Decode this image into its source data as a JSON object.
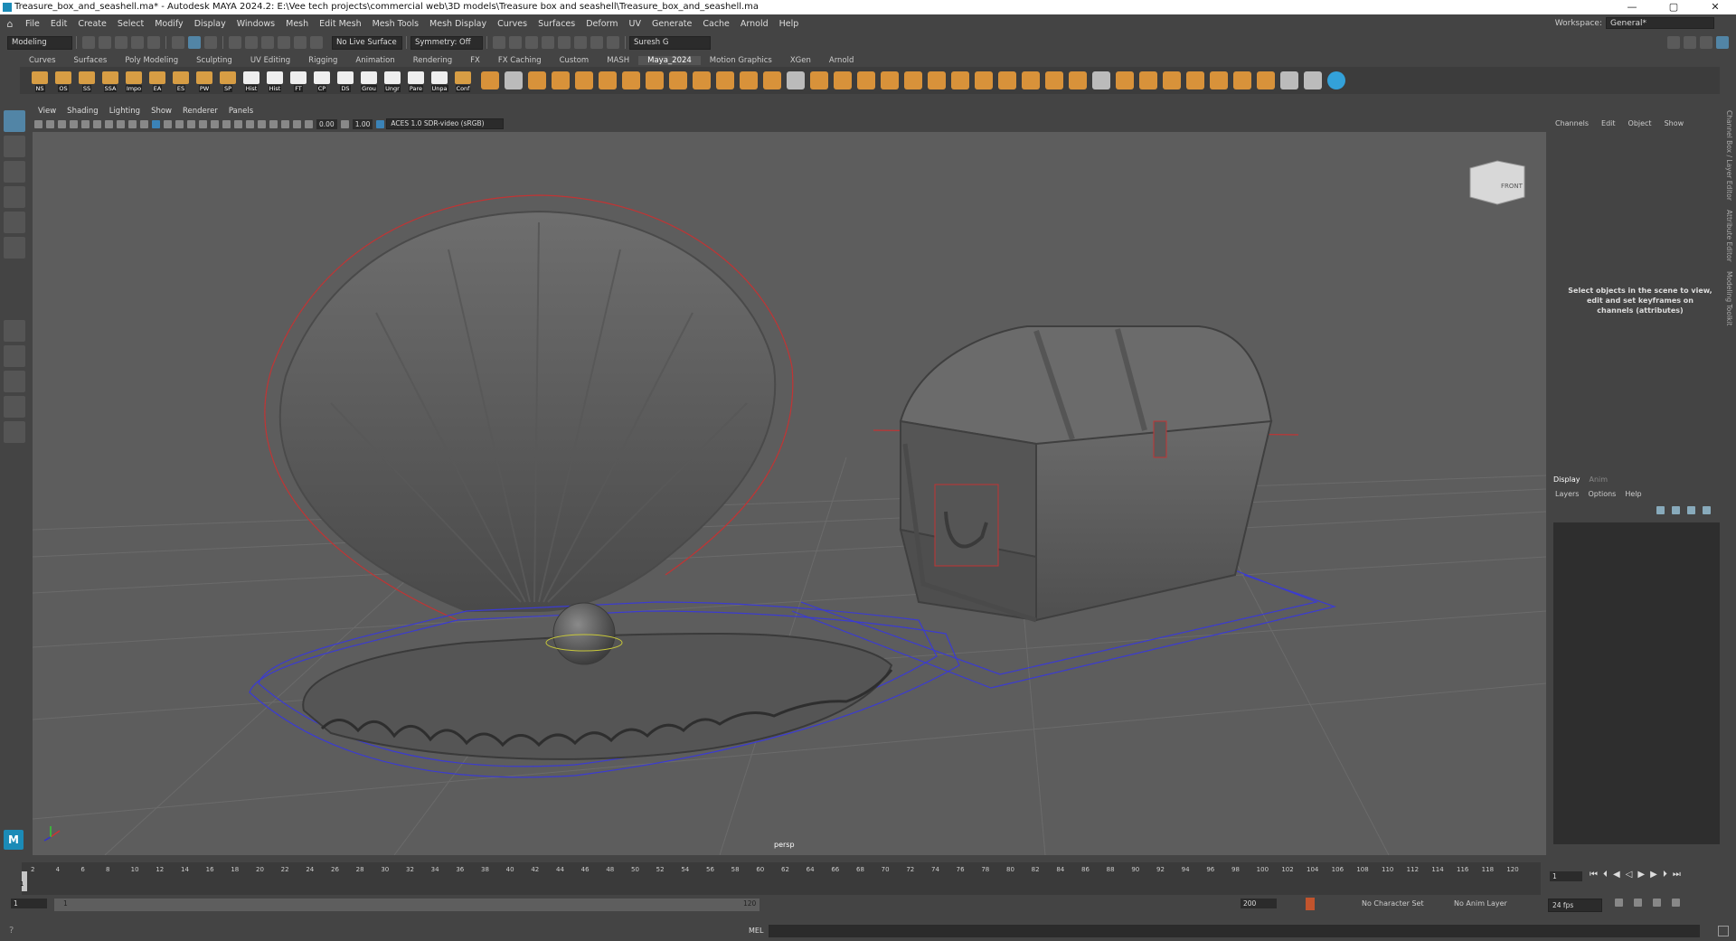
{
  "window": {
    "title": "Treasure_box_and_seashell.ma* - Autodesk MAYA 2024.2: E:\\Vee tech projects\\commercial web\\3D models\\Treasure box and seashell\\Treasure_box_and_seashell.ma",
    "minimize": "—",
    "maximize": "▢",
    "close": "✕"
  },
  "menubar": {
    "items": [
      "File",
      "Edit",
      "Create",
      "Select",
      "Modify",
      "Display",
      "Windows",
      "Mesh",
      "Edit Mesh",
      "Mesh Tools",
      "Mesh Display",
      "Curves",
      "Surfaces",
      "Deform",
      "UV",
      "Generate",
      "Cache",
      "Arnold",
      "Help"
    ],
    "workspace_label": "Workspace:",
    "workspace_value": "General*"
  },
  "statusline": {
    "mode": "Modeling",
    "live_surface": "No Live Surface",
    "symmetry": "Symmetry: Off",
    "user": "Suresh G"
  },
  "shelf": {
    "tabs": [
      "Curves",
      "Surfaces",
      "Poly Modeling",
      "Sculpting",
      "UV Editing",
      "Rigging",
      "Animation",
      "Rendering",
      "FX",
      "FX Caching",
      "Custom",
      "MASH",
      "Maya_2024",
      "Motion Graphics",
      "XGen",
      "Arnold"
    ],
    "active_tab": "Maya_2024",
    "buttons": [
      "NS",
      "OS",
      "SS",
      "SSA",
      "Impo",
      "EA",
      "ES",
      "PW",
      "SP",
      "Hist",
      "Hist",
      "FT",
      "CP",
      "DS",
      "Grou",
      "Ungr",
      "Pare",
      "Unpa",
      "Conf"
    ]
  },
  "panel": {
    "menus": [
      "View",
      "Shading",
      "Lighting",
      "Show",
      "Renderer",
      "Panels"
    ],
    "exposure": "0.00",
    "gamma": "1.00",
    "color_space": "ACES 1.0 SDR-video (sRGB)",
    "camera": "persp",
    "viewcube": "FRONT"
  },
  "channelbox": {
    "menus": [
      "Channels",
      "Edit",
      "Object",
      "Show"
    ],
    "message": "Select objects in the scene to view, edit and set keyframes on channels (attributes)"
  },
  "layers": {
    "tabs": [
      "Display",
      "Anim"
    ],
    "menus": [
      "Layers",
      "Options",
      "Help"
    ]
  },
  "sidetabs": [
    "Channel Box / Layer Editor",
    "Attribute Editor",
    "Modeling Toolkit"
  ],
  "timeline": {
    "frames": [
      "2",
      "4",
      "6",
      "8",
      "10",
      "12",
      "14",
      "16",
      "18",
      "20",
      "22",
      "24",
      "26",
      "28",
      "30",
      "32",
      "34",
      "36",
      "38",
      "40",
      "42",
      "44",
      "46",
      "48",
      "50",
      "52",
      "54",
      "56",
      "58",
      "60",
      "62",
      "64",
      "66",
      "68",
      "70",
      "72",
      "74",
      "76",
      "78",
      "80",
      "82",
      "84",
      "86",
      "88",
      "90",
      "92",
      "94",
      "96",
      "98",
      "100",
      "102",
      "104",
      "106",
      "108",
      "110",
      "112",
      "114",
      "116",
      "118",
      "120"
    ],
    "current_frame": "1",
    "current_marker": "1"
  },
  "range": {
    "start": "1",
    "inner_start": "1",
    "inner_end": "120",
    "end": "200",
    "character_set": "No Character Set",
    "anim_layer": "No Anim Layer",
    "fps": "24 fps"
  },
  "cmdline": {
    "label": "MEL"
  },
  "colors": {
    "accent": "#5285a6",
    "shelf_orange": "#d79d44",
    "viewport": "#5d5d5d"
  }
}
